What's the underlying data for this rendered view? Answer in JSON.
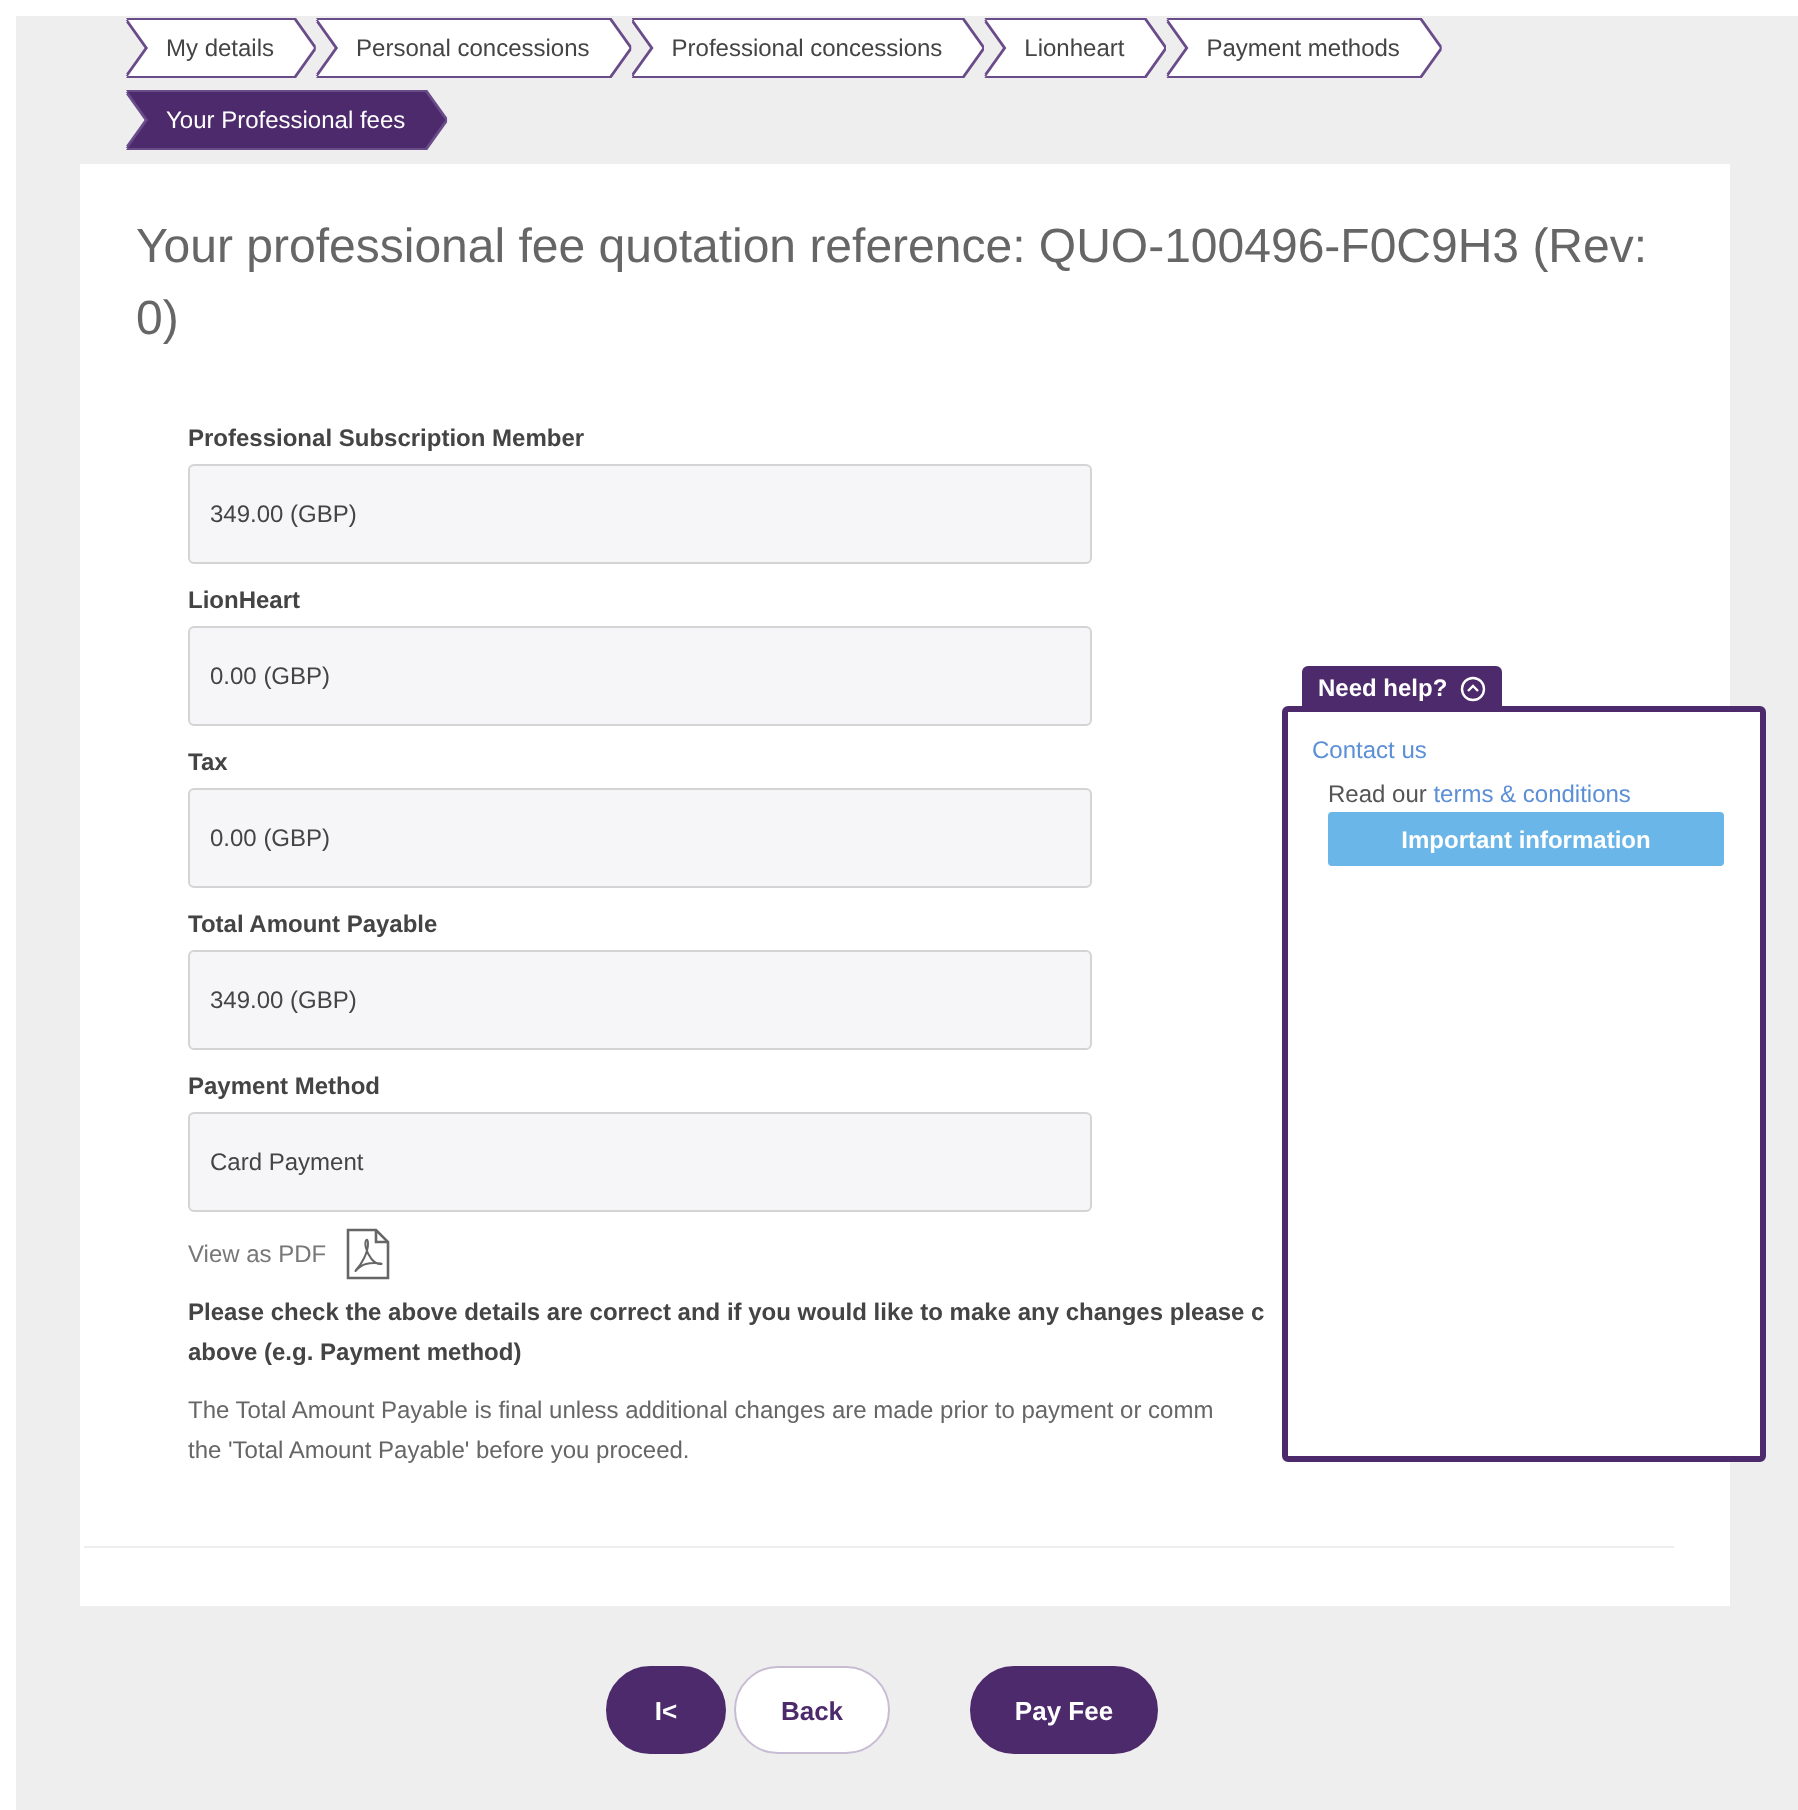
{
  "steps": [
    {
      "label": "My details",
      "selected": false
    },
    {
      "label": "Personal concessions",
      "selected": false
    },
    {
      "label": "Professional concessions",
      "selected": false
    },
    {
      "label": "Lionheart",
      "selected": false
    },
    {
      "label": "Payment methods",
      "selected": false
    },
    {
      "label": "Your Professional fees",
      "selected": true
    }
  ],
  "title": "Your professional fee quotation reference: QUO-100496-F0C9H3 (Rev: 0)",
  "fields": [
    {
      "label": "Professional Subscription Member",
      "value": "349.00 (GBP)"
    },
    {
      "label": "LionHeart",
      "value": "0.00 (GBP)"
    },
    {
      "label": "Tax",
      "value": "0.00 (GBP)"
    },
    {
      "label": "Total Amount Payable",
      "value": "349.00 (GBP)"
    },
    {
      "label": "Payment Method",
      "value": "Card Payment"
    }
  ],
  "pdf_link": "View as PDF",
  "notice_lines": [
    "Please check the above details are correct and if you would like to make any changes please c",
    "above (e.g. Payment method)"
  ],
  "info_lines": [
    "The Total Amount Payable is final unless additional changes are made prior to payment or comm",
    "the 'Total Amount Payable' before you proceed."
  ],
  "help": {
    "tab": "Need help?",
    "expanded": true,
    "contact": "Contact us",
    "read_prefix": "Read our",
    "terms_link": "terms & conditions",
    "info_button": "Important information"
  },
  "buttons": {
    "first": "I<",
    "back": "Back",
    "pay": "Pay Fee"
  }
}
